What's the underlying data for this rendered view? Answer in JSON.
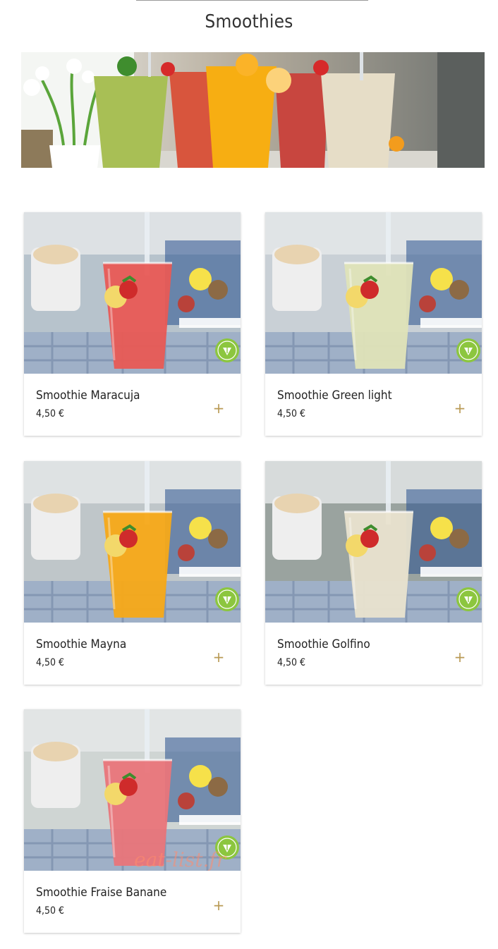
{
  "page": {
    "title": "Smoothies"
  },
  "products": [
    {
      "name": "Smoothie Maracuja",
      "price": "4,50 €",
      "add_label": "+",
      "drink_color": "#e85a55",
      "badge": "leaf-badge-icon"
    },
    {
      "name": "Smoothie Green light",
      "price": "4,50 €",
      "add_label": "+",
      "drink_color": "#dfe3b8",
      "badge": "leaf-badge-icon"
    },
    {
      "name": "Smoothie Mayna",
      "price": "4,50 €",
      "add_label": "+",
      "drink_color": "#f7a918",
      "badge": "leaf-badge-icon"
    },
    {
      "name": "Smoothie Golfino",
      "price": "4,50 €",
      "add_label": "+",
      "drink_color": "#e9e3cf",
      "badge": "leaf-badge-icon"
    },
    {
      "name": "Smoothie Fraise Banane",
      "price": "4,50 €",
      "add_label": "+",
      "drink_color": "#e9757a",
      "badge": "leaf-badge-icon"
    }
  ],
  "watermark": "eat-list.fr",
  "colors": {
    "accent_plus": "#b99a55",
    "badge_green": "#8cc63f"
  }
}
